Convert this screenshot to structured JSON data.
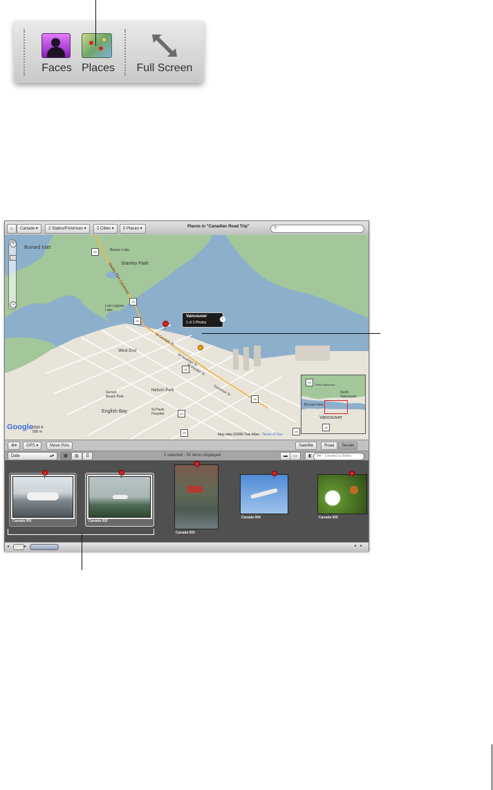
{
  "toolbar": {
    "buttons": [
      {
        "label": "Faces",
        "icon": "faces-icon"
      },
      {
        "label": "Places",
        "icon": "places-icon"
      },
      {
        "label": "Full Screen",
        "icon": "full-screen-icon"
      }
    ]
  },
  "window": {
    "breadcrumb": {
      "home_icon": "home-icon",
      "items": [
        "Canada",
        "2 States/Provinces",
        "2 Cities",
        "5 Places"
      ],
      "title": "Places in \"Canadian Road Trip\"",
      "search_placeholder": ""
    },
    "map": {
      "labels": [
        "Burrard Inlet",
        "Beaver Lake",
        "Stanley Park",
        "Lost Lagoon Lake",
        "West End",
        "Sunset Beach Park",
        "English Bay",
        "Nelson Park",
        "St Pauls Hospital",
        "W Georgia St",
        "W Hastings St",
        "W Pender St",
        "Dunsmuir St",
        "Stanley Park Causeway"
      ],
      "shields": [
        "99",
        "1A",
        "99",
        "1A",
        "1A",
        "7A",
        "99",
        "1A"
      ],
      "popup": {
        "title": "Vancouver",
        "subtitle": "1 of 2 Photos"
      },
      "inset_labels": [
        "West Vancouver",
        "North Vancouver",
        "Burrard Inlet",
        "Vancouver",
        "99",
        "1A"
      ],
      "google_logo": "Google",
      "scale": {
        "imperial": "2000 ft",
        "metric": "500 m"
      },
      "copyright": "Map data ©2009 Tele Atlas -",
      "terms": "Terms of Use"
    },
    "map_toolbar": {
      "gear_icon": "gear-icon",
      "gps_label": "GPS",
      "move_pins_label": "Move Pins",
      "map_types": [
        "Satellite",
        "Road",
        "Terrain"
      ],
      "selected_map_type": "Terrain"
    },
    "browser_bar": {
      "sort_value": "Date",
      "status": "2 selected - 50 items displayed",
      "filter_placeholder": "Unrated or Better"
    },
    "photos": [
      {
        "caption": "Canada 001",
        "selected": true
      },
      {
        "caption": "Canada 002",
        "selected": true
      },
      {
        "caption": "Canada 003",
        "selected": false
      },
      {
        "caption": "Canada 004",
        "selected": false
      },
      {
        "caption": "Canada 005",
        "selected": false
      }
    ]
  },
  "colors": {
    "water": "#8cb0cc",
    "park": "#9fc79a",
    "land": "#e8e4da",
    "browser_bg": "#505050",
    "pin": "#d22222"
  }
}
